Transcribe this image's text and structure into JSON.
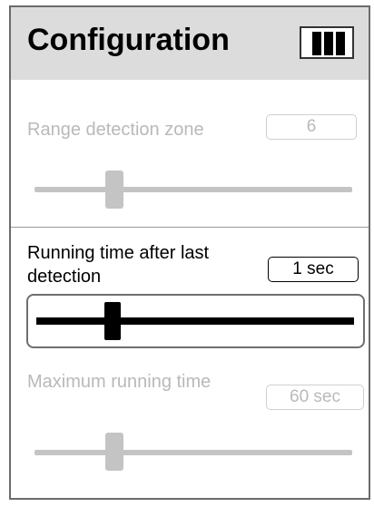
{
  "header": {
    "title": "Configuration",
    "menu_icon": "menu-bars-icon"
  },
  "settings": [
    {
      "label": "Range detection zone",
      "value": "6",
      "slider_level": 0.25,
      "state": "disabled"
    },
    {
      "label": "Running time after last detection",
      "value": "1 sec",
      "slider_level": 0.24,
      "state": "active"
    },
    {
      "label": "Maximum running time",
      "value": "60 sec",
      "slider_level": 0.25,
      "state": "disabled"
    }
  ],
  "colors": {
    "header_bg": "#dcdcdc",
    "disabled_text": "#b9b9b9",
    "active_text": "#000000",
    "border": "#6b6b6b"
  }
}
